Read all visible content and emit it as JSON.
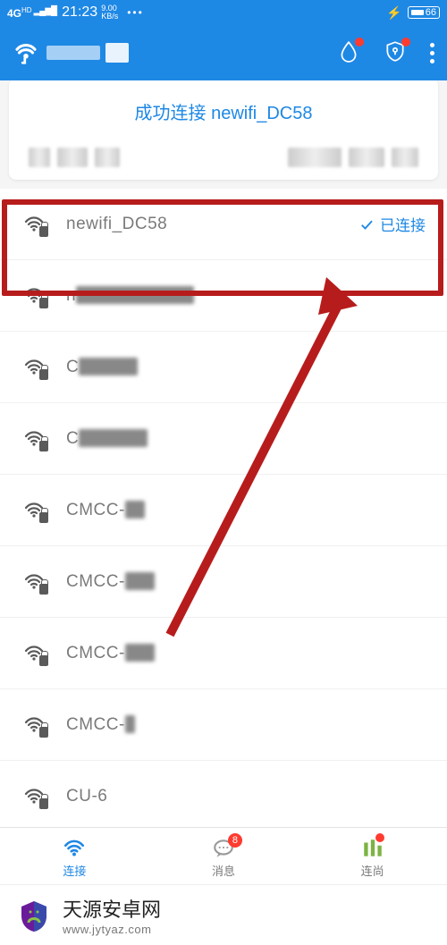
{
  "status": {
    "net_label": "4G",
    "net_hd": "HD",
    "time": "21:23",
    "speed_val": "9.00",
    "speed_unit": "KB/s",
    "battery": "66"
  },
  "card": {
    "title": "成功连接 newifi_DC58"
  },
  "wifi": {
    "items": [
      {
        "ssid": "newifi_DC58",
        "connected": true,
        "status_label": "已连接"
      },
      {
        "ssid": "newifi5G_DC58",
        "connected": false
      },
      {
        "ssid": "CMCC-Md",
        "connected": false
      },
      {
        "ssid": "CMCC-7J3",
        "connected": false
      },
      {
        "ssid": "CMCC-10",
        "connected": false
      },
      {
        "ssid": "CMCC-300",
        "connected": false
      },
      {
        "ssid": "CMCC-800",
        "connected": false
      },
      {
        "ssid": "CMCC-2",
        "connected": false
      },
      {
        "ssid": "CU-6",
        "connected": false
      },
      {
        "ssid": "",
        "connected": false
      }
    ]
  },
  "nav": {
    "items": [
      {
        "label": "连接",
        "active": true
      },
      {
        "label": "消息",
        "badge": "8"
      },
      {
        "label": "连尚",
        "dot": true
      },
      {
        "label": "",
        "dot": false
      }
    ]
  },
  "watermark": {
    "name": "天源安卓网",
    "url": "www.jytyaz.com"
  }
}
